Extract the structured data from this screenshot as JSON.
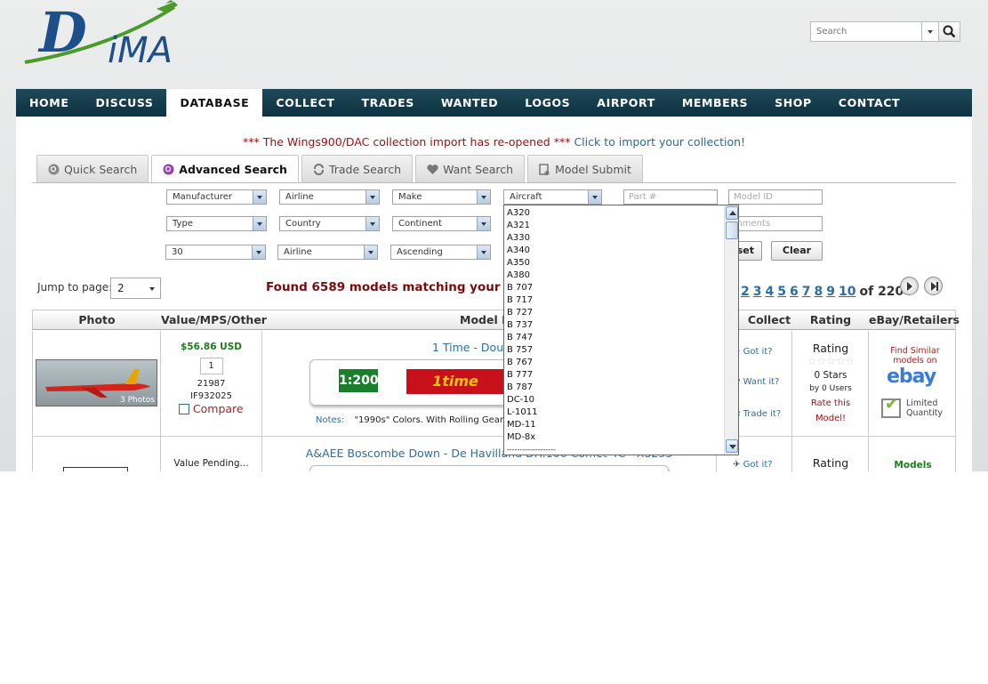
{
  "header": {
    "logo_text": "DiMA",
    "search_placeholder": "Search"
  },
  "nav": [
    "HOME",
    "DISCUSS",
    "DATABASE",
    "COLLECT",
    "TRADES",
    "WANTED",
    "LOGOS",
    "AIRPORT",
    "MEMBERS",
    "SHOP",
    "CONTACT"
  ],
  "nav_active": "DATABASE",
  "announcement": {
    "text": "*** The Wings900/DAC collection import has re-opened ***",
    "link": "Click to import your collection!"
  },
  "tabs": [
    {
      "label": "Quick Search",
      "active": false
    },
    {
      "label": "Advanced Search",
      "active": true
    },
    {
      "label": "Trade Search",
      "active": false
    },
    {
      "label": "Want Search",
      "active": false
    },
    {
      "label": "Model Submit",
      "active": false
    }
  ],
  "filters": {
    "manufacturer": "Manufacturer",
    "airline": "Airline",
    "make": "Make",
    "aircraft": "Aircraft",
    "part_placeholder": "Part #",
    "model_id_placeholder": "Model ID",
    "type": "Type",
    "country": "Country",
    "continent": "Continent",
    "comments_placeholder": "mments",
    "per_page": "30",
    "sort_by": "Airline",
    "order": "Ascending",
    "reset_label": "set",
    "clear_label": "Clear"
  },
  "aircraft_options": [
    "A320",
    "A321",
    "A330",
    "A340",
    "A350",
    "A380",
    "B 707",
    "B 717",
    "B 727",
    "B 737",
    "B 747",
    "B 757",
    "B 767",
    "B 777",
    "B 787",
    "DC-10",
    "L-1011",
    "MD-11",
    "MD-8x",
    "-------------------"
  ],
  "pagination": {
    "jump_label": "Jump to page:",
    "jump_value": "2",
    "found_text": "Found 6589 models matching your se",
    "pages": [
      "2",
      "3",
      "4",
      "5",
      "6",
      "7",
      "8",
      "9",
      "10"
    ],
    "of_text": "of 220"
  },
  "table": {
    "headers": [
      "Photo",
      "Value/MPS/Other",
      "Model De",
      "Collect",
      "Rating",
      "eBay/Retailers"
    ],
    "rows": [
      {
        "price": "$56.86 USD",
        "qty": "1",
        "mps": "21987",
        "part": "IF932025",
        "compare": "Compare",
        "photos": "3 Photos",
        "title": "1 Time - Douglas DC",
        "scale": "1:200",
        "airline_logo": "1time",
        "notes_label": "Notes:",
        "notes": "\"1990s\" Colors. With Rolling Gears",
        "got_it": "Got it?",
        "want_it": "Want it?",
        "trade_it": "Trade it?",
        "rating_title": "Rating",
        "stars_text": "0 Stars",
        "users_text": "by 0 Users",
        "rate_link": "Rate this Model!",
        "ebay_find": "Find Similar models on",
        "ebay_brand": "ebay",
        "limited": "Limited Quantity"
      },
      {
        "price": "Value Pending...",
        "title": "A&AEE Boscombe Down - De Havilland DH.106 Comet 4C - XS235",
        "got_it": "Got it?",
        "rating_title": "Rating",
        "retailer": "Models"
      }
    ]
  },
  "colors": {
    "nav_bg": "#0d3140",
    "link": "#2b6ea6",
    "found": "#7a0c0c",
    "price": "#1d7d1d"
  }
}
